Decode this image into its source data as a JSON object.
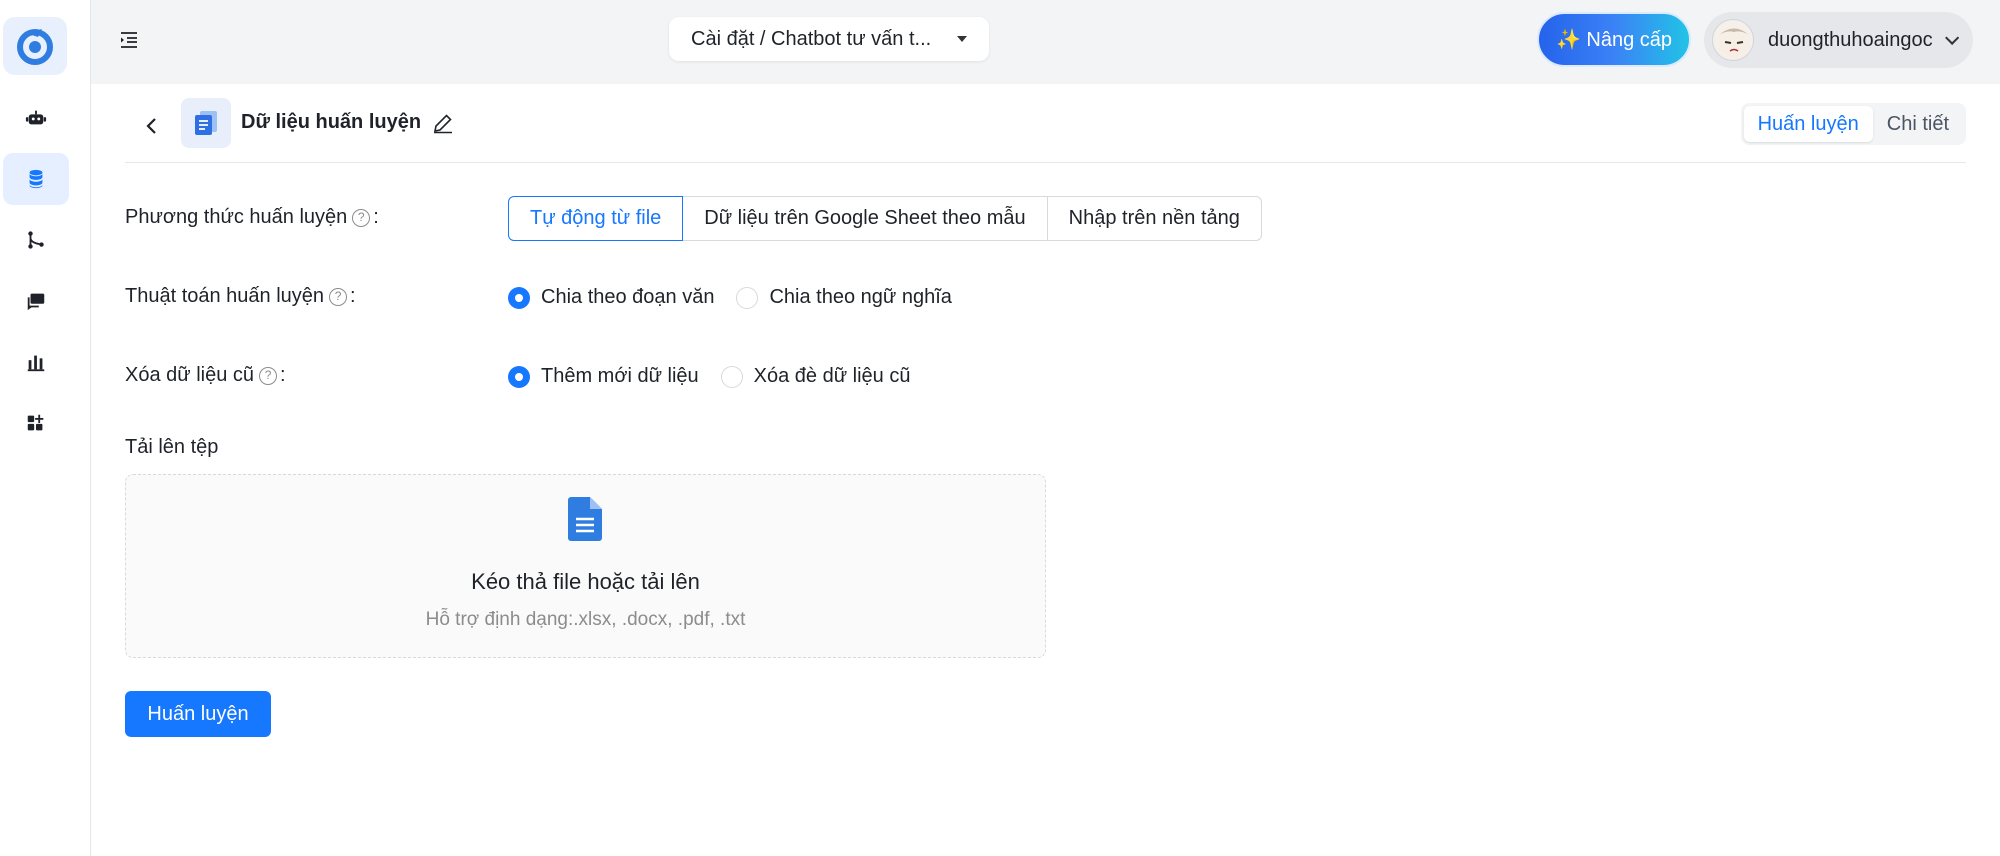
{
  "topbar": {
    "breadcrumb": "Cài đặt / Chatbot tư vấn t...",
    "upgrade_label": "✨ Nâng cấp",
    "user_name": "duongthuhoaingoc"
  },
  "sidebar": {
    "items": [
      {
        "name": "bot-icon",
        "active": false
      },
      {
        "name": "database-icon",
        "active": true
      },
      {
        "name": "flow-icon",
        "active": false
      },
      {
        "name": "chat-icon",
        "active": false
      },
      {
        "name": "chart-icon",
        "active": false
      },
      {
        "name": "apps-icon",
        "active": false
      }
    ]
  },
  "header": {
    "title": "Dữ liệu huấn luyện",
    "tabs": [
      "Huấn luyện",
      "Chi tiết"
    ],
    "active_tab": "Huấn luyện"
  },
  "form": {
    "method": {
      "label": "Phương thức huấn luyện",
      "options": [
        "Tự động từ file",
        "Dữ liệu trên Google Sheet theo mẫu",
        "Nhập trên nền tảng"
      ],
      "selected": "Tự động từ file"
    },
    "algorithm": {
      "label": "Thuật toán huấn luyện",
      "options": [
        "Chia theo đoạn văn",
        "Chia theo ngữ nghĩa"
      ],
      "selected": "Chia theo đoạn văn"
    },
    "delete_old": {
      "label": "Xóa dữ liệu cũ",
      "options": [
        "Thêm mới dữ liệu",
        "Xóa đè dữ liệu cũ"
      ],
      "selected": "Thêm mới dữ liệu"
    },
    "colon": ":"
  },
  "upload": {
    "label": "Tải lên tệp",
    "title": "Kéo thả file hoặc tải lên",
    "subtitle": "Hỗ trợ định dạng:.xlsx, .docx, .pdf, .txt"
  },
  "actions": {
    "train_label": "Huấn luyện"
  },
  "colors": {
    "primary": "#1677ff",
    "sidebar_active_bg": "#e6efff",
    "topbar_bg": "#f3f4f6"
  }
}
